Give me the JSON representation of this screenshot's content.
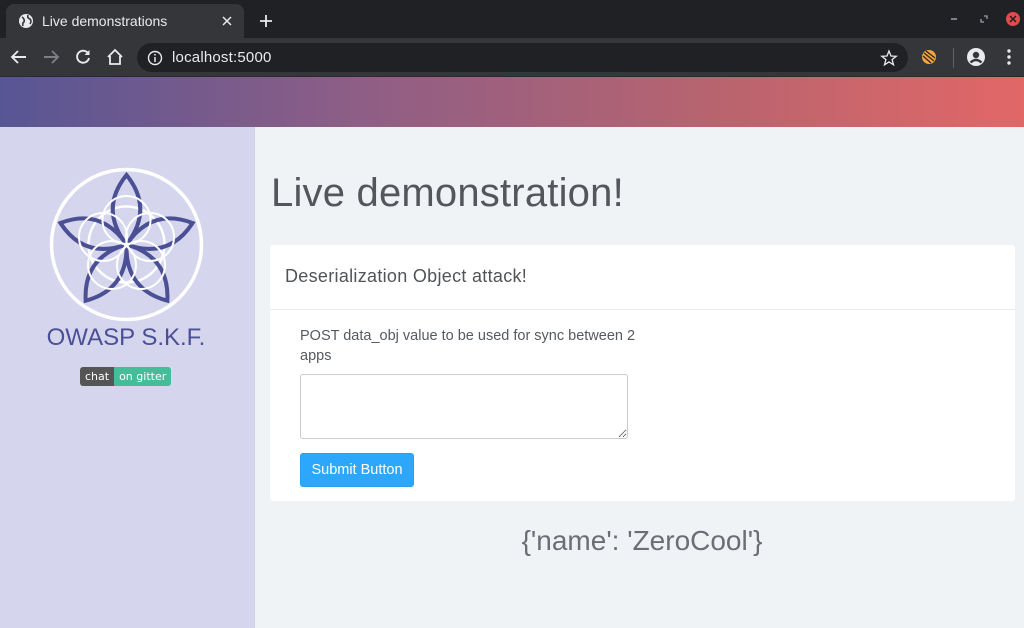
{
  "browser": {
    "tab_title": "Live demonstrations",
    "url": "localhost:5000",
    "icons": {
      "favicon": "globe-icon",
      "tab_close": "close-icon",
      "new_tab": "plus-icon",
      "minimize": "minimize-icon",
      "restore": "restore-icon",
      "close_window": "close-window-icon",
      "back": "back-arrow-icon",
      "forward": "forward-arrow-icon",
      "reload": "reload-icon",
      "home": "home-icon",
      "site_info": "info-icon",
      "bookmark": "star-icon",
      "extension": "extension-icon",
      "profile": "profile-icon",
      "menu": "kebab-menu-icon"
    }
  },
  "sidebar": {
    "brand": "OWASP S.K.F.",
    "badge": {
      "left": "chat",
      "right": "on gitter"
    }
  },
  "main": {
    "title": "Live demonstration!",
    "card": {
      "header": "Deserialization Object attack!",
      "field_label": "POST data_obj value to be used for sync between 2 apps",
      "textarea_value": "",
      "submit_label": "Submit Button"
    },
    "result": "{'name': 'ZeroCool'}"
  },
  "colors": {
    "banner_gradient": [
      "#575694",
      "#e26767"
    ],
    "sidebar_bg": "#d5d6ee",
    "brand": "#4b4f94",
    "button": "#2ca7fb",
    "badge_right": "#46bc99"
  }
}
